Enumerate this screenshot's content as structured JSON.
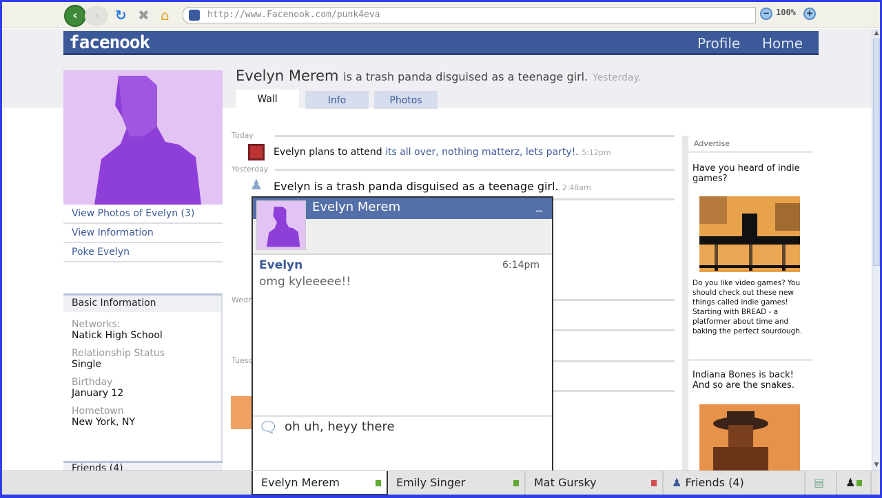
{
  "browser": {
    "url": "http://www.Facenook.com/punk4eva",
    "zoom": "100%",
    "icons": [
      "back-arrow-icon",
      "forward-arrow-icon",
      "refresh-icon",
      "stop-icon",
      "home-icon",
      "site-lock-icon",
      "zoom-out-icon",
      "zoom-in-icon"
    ]
  },
  "header": {
    "logo": "facenook",
    "nav": [
      "Profile",
      "Home"
    ]
  },
  "profile": {
    "name": "Evelyn Merem",
    "status": "is a trash panda disguised as a teenage girl.",
    "status_time": "Yesterday.",
    "tabs": [
      "Wall",
      "Info",
      "Photos"
    ],
    "active_tab": "Wall"
  },
  "left": {
    "links": [
      "View Photos of Evelyn (3)",
      "View Information",
      "Poke Evelyn"
    ],
    "basic_info": {
      "title": "Basic Information",
      "fields": [
        {
          "label": "Networks:",
          "value": "Natick High School"
        },
        {
          "label": "Relationship Status",
          "value": "Single"
        },
        {
          "label": "Birthday",
          "value": "January 12"
        },
        {
          "label": "Hometown",
          "value": "New York, NY"
        }
      ]
    },
    "friends": "Friends (4)"
  },
  "wall": {
    "days": [
      "Today",
      "Yesterday",
      "Wednesday",
      "Tuesday"
    ],
    "posts": [
      {
        "text": "Evelyn plans to attend ",
        "link": "its all over, nothing matterz, lets party!",
        "suffix": ".",
        "time": "5:12pm",
        "icon": "event-icon"
      },
      {
        "text": "Evelyn is a trash panda disguised as a teenage girl.",
        "time": "2:48am",
        "icon": "status-icon"
      }
    ]
  },
  "chat": {
    "name": "Evelyn Merem",
    "minimize": "_",
    "messages": [
      {
        "from": "Evelyn",
        "time": "6:14pm",
        "text": "omg kyleeeee!!"
      }
    ],
    "input": "oh uh, heyy there"
  },
  "ads": {
    "header": "Advertise",
    "items": [
      {
        "title": "Have you heard of indie games?",
        "body": "Do you like video games? You should check out these new things called indie games! Starting with BREAD - a platformer about time and baking the perfect sourdough."
      },
      {
        "title": "Indiana Bones is back! And so are the snakes."
      }
    ]
  },
  "taskbar": {
    "chats": [
      {
        "name": "Evelyn Merem",
        "status": "online",
        "color": "#5fa832"
      },
      {
        "name": "Emily Singer",
        "status": "online",
        "color": "#5fa832"
      },
      {
        "name": "Mat Gursky",
        "status": "offline",
        "color": "#d05050"
      }
    ],
    "friends": "Friends (4)"
  },
  "colors": {
    "brand": "#3c5a99",
    "border": "#2f3ee6"
  }
}
